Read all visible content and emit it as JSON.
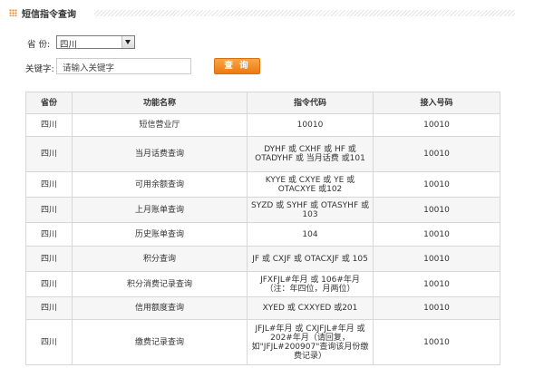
{
  "header": {
    "title": "短信指令查询",
    "icon": "grid-dots-icon",
    "accent": "#f0862a"
  },
  "form": {
    "province_label": "省  份:",
    "province_value": "四川",
    "keyword_label": "关键字:",
    "keyword_value": "请输入关键字",
    "search_label": "查 询"
  },
  "table": {
    "headers": [
      "省份",
      "功能名称",
      "指令代码",
      "接入号码"
    ],
    "rows": [
      {
        "province": "四川",
        "func": "短信营业厅",
        "code": "10010",
        "number": "10010"
      },
      {
        "province": "四川",
        "func": "当月话费查询",
        "code": "DYHF 或 CXHF 或 HF 或 OTADYHF 或 当月话费 或101",
        "number": "10010"
      },
      {
        "province": "四川",
        "func": "可用余额查询",
        "code": "KYYE 或 CXYE 或 YE 或 OTACXYE 或102",
        "number": "10010"
      },
      {
        "province": "四川",
        "func": "上月账单查询",
        "code": "SYZD 或 SYHF 或 OTASYHF 或103",
        "number": "10010"
      },
      {
        "province": "四川",
        "func": "历史账单查询",
        "code": "104",
        "number": "10010"
      },
      {
        "province": "四川",
        "func": "积分查询",
        "code": "JF 或 CXJF 或 OTACXJF 或 105",
        "number": "10010"
      },
      {
        "province": "四川",
        "func": "积分消费记录查询",
        "code": "JFXFJL#年月 或 106#年月（注：年四位，月两位）",
        "number": "10010"
      },
      {
        "province": "四川",
        "func": "信用额度查询",
        "code": "XYED 或 CXXYED 或201",
        "number": "10010"
      },
      {
        "province": "四川",
        "func": "缴费记录查询",
        "code": "JFJL#年月 或 CXJFJL#年月 或202#年月（请回复，如\"JFJL#200907\"查询该月份缴费记录）",
        "number": "10010"
      }
    ]
  }
}
